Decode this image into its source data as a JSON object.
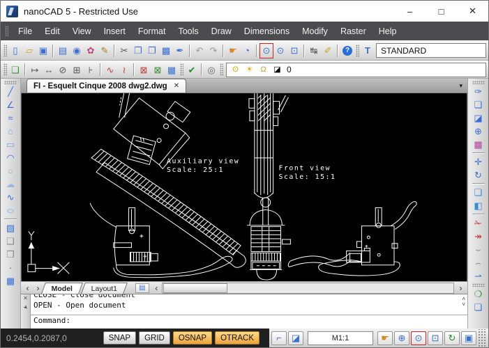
{
  "window": {
    "title": "nanoCAD 5 - Restricted Use"
  },
  "controls": {
    "minimize": "–",
    "maximize": "□",
    "close": "✕"
  },
  "menu": {
    "items": [
      "File",
      "Edit",
      "View",
      "Insert",
      "Format",
      "Tools",
      "Draw",
      "Dimensions",
      "Modify",
      "Raster",
      "Help"
    ]
  },
  "toolbar_main": {
    "items": [
      {
        "handle": true
      },
      {
        "name": "new-document",
        "glyph": "▯",
        "color": "#3a6fd8"
      },
      {
        "name": "open-document",
        "glyph": "▱",
        "color": "#c9a227"
      },
      {
        "name": "save-document",
        "glyph": "▣",
        "color": "#3a6fd8"
      },
      {
        "sep": true
      },
      {
        "name": "plot",
        "glyph": "▤",
        "color": "#3a6fd8"
      },
      {
        "name": "plot-preview",
        "glyph": "◉",
        "color": "#3a6fd8"
      },
      {
        "name": "batch-plot",
        "glyph": "✿",
        "color": "#c2427e"
      },
      {
        "name": "page-setup",
        "glyph": "✎",
        "color": "#b07a2a"
      },
      {
        "sep": true
      },
      {
        "name": "cut",
        "glyph": "✂",
        "color": "#555555"
      },
      {
        "name": "copy",
        "glyph": "❐",
        "color": "#3a6fd8"
      },
      {
        "name": "paste",
        "glyph": "❒",
        "color": "#3a6fd8"
      },
      {
        "name": "copy-with-basepoint",
        "glyph": "▩",
        "color": "#3a6fd8"
      },
      {
        "name": "format-painter",
        "glyph": "✒",
        "color": "#3a6fd8"
      },
      {
        "sep": true
      },
      {
        "name": "undo",
        "glyph": "↶",
        "color": "#9a9a9a"
      },
      {
        "name": "redo",
        "glyph": "↷",
        "color": "#9a9a9a"
      },
      {
        "sep": true
      },
      {
        "name": "pan",
        "glyph": "☛",
        "color": "#d8862a"
      },
      {
        "name": "zoom-previous",
        "glyph": "◔",
        "color": "#3a6fd8"
      },
      {
        "sep": true
      },
      {
        "name": "zoom-window",
        "glyph": "⊙",
        "color": "#3a6fd8",
        "active": true
      },
      {
        "name": "zoom-dynamic",
        "glyph": "⊙",
        "color": "#3a6fd8"
      },
      {
        "name": "zoom-extents",
        "glyph": "⊡",
        "color": "#3a6fd8"
      },
      {
        "sep": true
      },
      {
        "name": "measure-distance",
        "glyph": "↹",
        "color": "#555555"
      },
      {
        "name": "measure-ruler",
        "glyph": "✐",
        "color": "#c9a227"
      },
      {
        "sep": true
      },
      {
        "name": "help",
        "glyph": "?",
        "cls": "help"
      },
      {
        "handle": true
      },
      {
        "name": "text-style",
        "glyph": "T",
        "color": "#3a6fd8",
        "cls": "bold"
      }
    ],
    "style_combo": {
      "value": "STANDARD"
    }
  },
  "toolbar_dim": {
    "items": [
      {
        "handle": true
      },
      {
        "name": "copy-properties",
        "glyph": "❏",
        "color": "#3a8a3a"
      },
      {
        "sep": true
      },
      {
        "name": "dim-aligned",
        "glyph": "↦",
        "color": "#555555"
      },
      {
        "name": "dim-linear",
        "glyph": "↔",
        "color": "#555555"
      },
      {
        "name": "dim-none",
        "glyph": "⊘",
        "color": "#555555"
      },
      {
        "name": "dim-group",
        "glyph": "⊞",
        "color": "#555555"
      },
      {
        "name": "dim-baseline",
        "glyph": "⊦",
        "color": "#555555"
      },
      {
        "sep": true
      },
      {
        "name": "spline-edit",
        "glyph": "∿",
        "color": "#c03a3a"
      },
      {
        "name": "spline-frame",
        "glyph": "≀",
        "color": "#c03a3a"
      },
      {
        "sep": true
      },
      {
        "name": "export-xref",
        "glyph": "⊠",
        "color": "#c03a3a"
      },
      {
        "name": "import-xref",
        "glyph": "⊠",
        "color": "#3a8a3a"
      },
      {
        "name": "table-edit",
        "glyph": "▦",
        "color": "#3a6fd8"
      },
      {
        "handle": true
      },
      {
        "name": "standards-check",
        "glyph": "✔",
        "color": "#2a8a2a"
      },
      {
        "sep": true
      },
      {
        "name": "find",
        "glyph": "◎",
        "color": "#666666"
      },
      {
        "handle": true
      }
    ],
    "layer_combo": {
      "value": "0",
      "icons": [
        {
          "name": "layer-on-bulb",
          "glyph": "ʘ",
          "color": "#e0a800"
        },
        {
          "name": "layer-freeze-sun",
          "glyph": "☀",
          "color": "#e8a000"
        },
        {
          "name": "layer-unlock",
          "glyph": "Ω",
          "color": "#c9a227"
        },
        {
          "name": "layer-color-swatch",
          "glyph": "◪",
          "color": "#000000"
        }
      ]
    }
  },
  "doc_tab": {
    "title": "FI - Esquelt Cinque 2008 dwg2.dwg",
    "close": "✕",
    "overflow": "▾"
  },
  "draw_toolbar": {
    "items": [
      {
        "handle": true
      },
      {
        "name": "draw-line",
        "glyph": "╱",
        "color": "#3a6fd8"
      },
      {
        "name": "draw-polyline",
        "glyph": "∠",
        "color": "#3a6fd8"
      },
      {
        "name": "draw-spline-cv",
        "glyph": "≈",
        "color": "#3a6fd8"
      },
      {
        "name": "draw-polygon",
        "glyph": "⌂",
        "color": "#7aa8d8"
      },
      {
        "name": "draw-rectangle",
        "glyph": "▭",
        "color": "#7aa8d8"
      },
      {
        "name": "draw-arc",
        "glyph": "◠",
        "color": "#3a6fd8"
      },
      {
        "name": "draw-circle",
        "glyph": "○",
        "color": "#7aa8d8"
      },
      {
        "name": "draw-cloud",
        "glyph": "☁",
        "color": "#9ab8d8"
      },
      {
        "name": "draw-spline",
        "glyph": "∿",
        "color": "#3a6fd8"
      },
      {
        "name": "draw-ellipse",
        "glyph": "○",
        "color": "#7aa8d8",
        "cls": "ellipse"
      },
      {
        "sep": true
      },
      {
        "name": "draw-hatch",
        "glyph": "▨",
        "color": "#3a6fd8"
      },
      {
        "name": "create-block",
        "glyph": "❑",
        "color": "#888888"
      },
      {
        "name": "insert-block",
        "glyph": "❒",
        "color": "#888888"
      },
      {
        "name": "point-style",
        "glyph": "·",
        "color": "#555555"
      },
      {
        "name": "insert-table",
        "glyph": "▦",
        "color": "#3a6fd8"
      }
    ]
  },
  "modify_toolbar": {
    "items": [
      {
        "handle": true
      },
      {
        "name": "match-properties",
        "glyph": "✑",
        "color": "#3a6fd8"
      },
      {
        "name": "copy-object",
        "glyph": "❏",
        "color": "#3a6fd8"
      },
      {
        "name": "erase",
        "glyph": "◪",
        "color": "#3a6fd8"
      },
      {
        "name": "boundary",
        "glyph": "⊕",
        "color": "#3a6fd8"
      },
      {
        "name": "array",
        "glyph": "▩",
        "color": "#b04a9a"
      },
      {
        "sep": true
      },
      {
        "name": "move",
        "glyph": "✛",
        "color": "#3a6fd8"
      },
      {
        "name": "rotate",
        "glyph": "↻",
        "color": "#3a6fd8"
      },
      {
        "sep": true
      },
      {
        "name": "scale",
        "glyph": "❏",
        "color": "#3a8ad8"
      },
      {
        "name": "stretch",
        "glyph": "◧",
        "color": "#3a8ad8"
      },
      {
        "sep": true
      },
      {
        "name": "trim",
        "glyph": "✁",
        "color": "#c03a3a"
      },
      {
        "name": "extend",
        "glyph": "↠",
        "color": "#c03a3a"
      },
      {
        "name": "break",
        "glyph": "⌣",
        "color": "#888888"
      },
      {
        "name": "join",
        "glyph": "⌢",
        "color": "#888888"
      },
      {
        "name": "measure-align",
        "glyph": "⇀",
        "color": "#3a6fd8"
      },
      {
        "handle": true
      },
      {
        "name": "draw-order",
        "glyph": "❍",
        "color": "#2a8a2a"
      },
      {
        "name": "properties-sheet",
        "glyph": "❏",
        "color": "#3a6fd8"
      }
    ]
  },
  "canvas": {
    "views": [
      {
        "line1": "Auxiliary view",
        "line2": "Scale:  25:1"
      },
      {
        "line1": "Front view",
        "line2": "Scale:  15:1"
      }
    ]
  },
  "nav": {
    "prev": "‹",
    "next": "›",
    "tabs": [
      {
        "label": "Model",
        "active": true
      },
      {
        "label": "Layout1",
        "active": false
      }
    ],
    "sheet_button": {
      "glyph": "▤"
    },
    "scroll_left": "‹",
    "scroll_right": "›"
  },
  "command": {
    "history": [
      "CLOSE - Close document",
      "OPEN - Open document"
    ],
    "prompt": "Command:",
    "close": "✕",
    "pin": "➤",
    "scroll_up": "˄",
    "scroll_down": "˅"
  },
  "statusbar": {
    "coords": "0.2454,0.2087,0",
    "toggles": [
      {
        "label": "SNAP",
        "active": false
      },
      {
        "label": "GRID",
        "active": false
      },
      {
        "label": "OSNAP",
        "active": true
      },
      {
        "label": "OTRACK",
        "active": true
      }
    ],
    "left_icons": [
      {
        "name": "ucs-toggle",
        "glyph": "⌐",
        "color": "#3a6fd8"
      },
      {
        "name": "grid-display",
        "glyph": "◪",
        "color": "#3a6fd8"
      }
    ],
    "scale": "M1:1",
    "right_icons": [
      {
        "name": "status-pan",
        "glyph": "☛",
        "color": "#d8862a"
      },
      {
        "name": "status-zoom-in",
        "glyph": "⊕",
        "color": "#3a6fd8"
      },
      {
        "name": "status-zoom-window",
        "glyph": "⊙",
        "color": "#3a6fd8",
        "active": true
      },
      {
        "name": "status-zoom-extents",
        "glyph": "⊡",
        "color": "#3a6fd8"
      },
      {
        "name": "status-regen",
        "glyph": "↻",
        "color": "#2a8a2a"
      },
      {
        "name": "status-fullscreen",
        "glyph": "▣",
        "color": "#3a6fd8"
      }
    ]
  },
  "colors": {
    "canvas_bg": "#000000",
    "line": "#ffffff",
    "menu_bg": "#4c4c4e",
    "status_bg": "#202020",
    "toggle_active": "#eda33c",
    "zoom_active_frame": "#cc2222"
  }
}
